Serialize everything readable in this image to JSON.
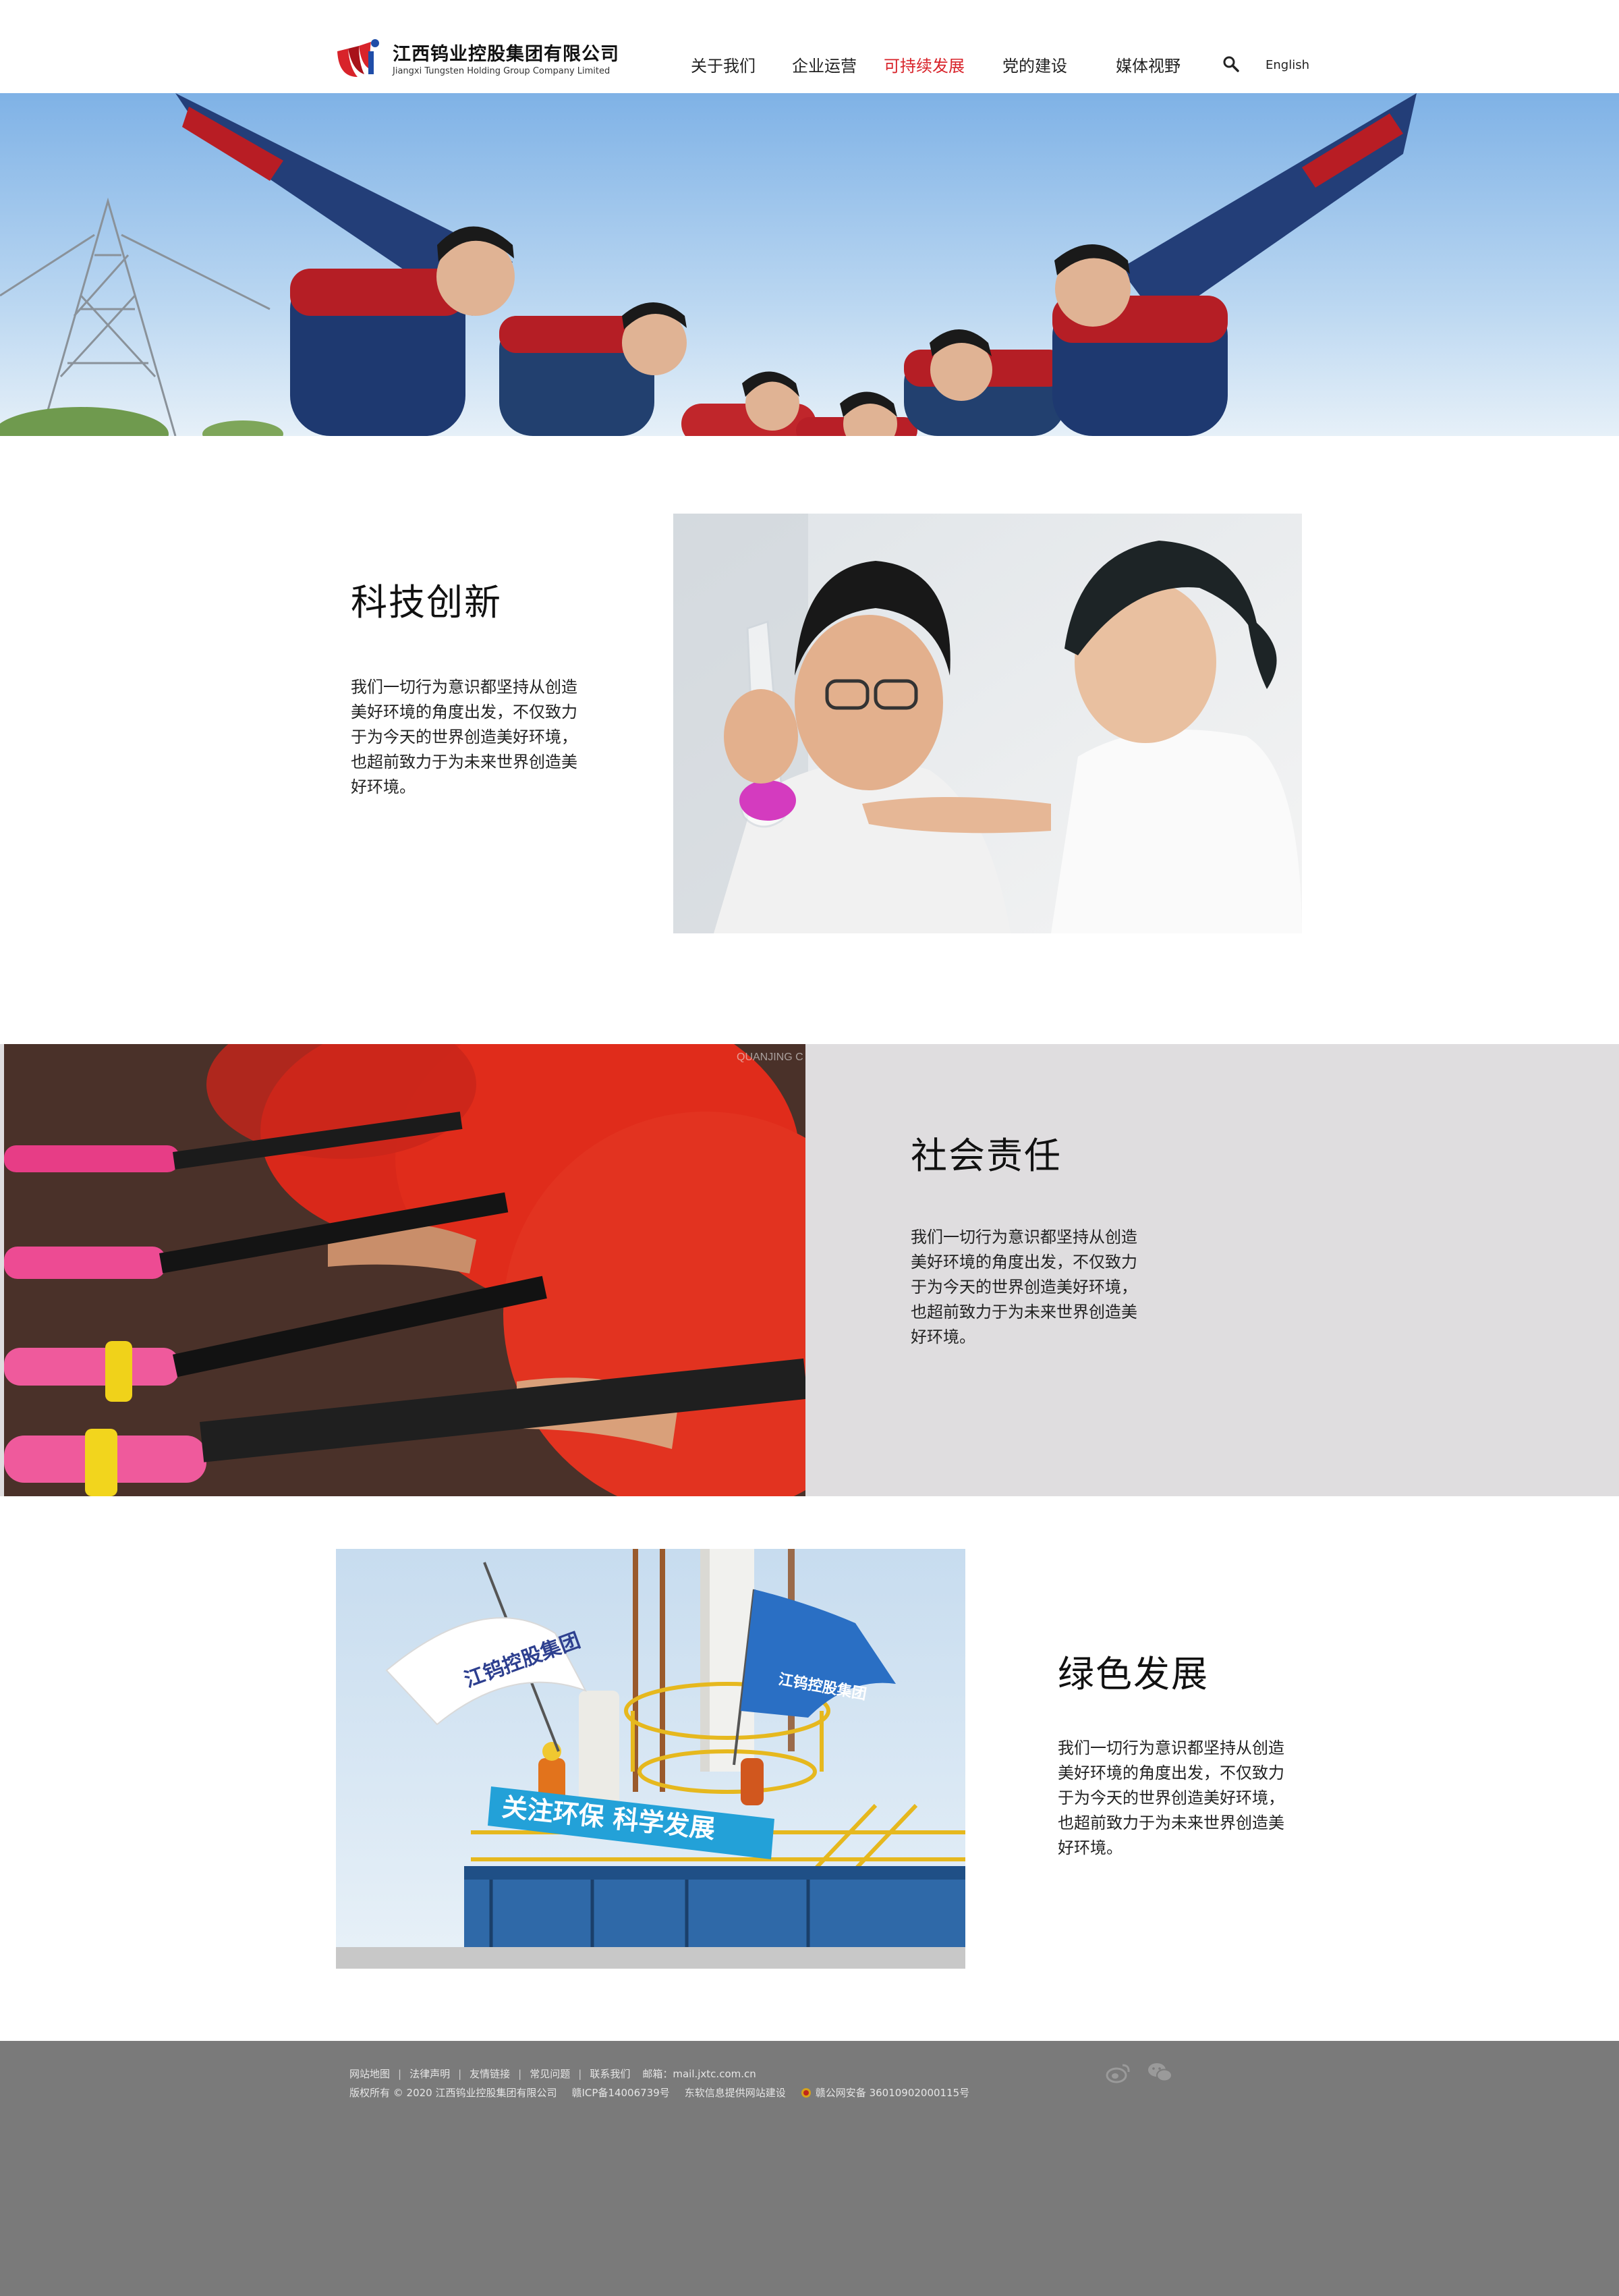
{
  "header": {
    "logo_cn": "江西钨业控股集团有限公司",
    "logo_en": "Jiangxi Tungsten Holding Group Company Limited",
    "nav": [
      {
        "label": "关于我们",
        "active": false
      },
      {
        "label": "企业运营",
        "active": false
      },
      {
        "label": "可持续发展",
        "active": true
      },
      {
        "label": "党的建设",
        "active": false
      },
      {
        "label": "媒体视野",
        "active": false
      }
    ],
    "search_icon": "search-icon",
    "lang_label": "English"
  },
  "sections": {
    "tech": {
      "title": "科技创新",
      "body": "我们一切行为意识都坚持从创造美好环境的角度出发，不仅致力于为今天的世界创造美好环境，也超前致力于为未来世界创造美好环境。"
    },
    "social": {
      "title": "社会责任",
      "body": "我们一切行为意识都坚持从创造美好环境的角度出发，不仅致力于为今天的世界创造美好环境，也超前致力于为未来世界创造美好环境。",
      "photo_watermark": "QUANJING C"
    },
    "green": {
      "title": "绿色发展",
      "body": "我们一切行为意识都坚持从创造美好环境的角度出发，不仅致力于为今天的世界创造美好环境，也超前致力于为未来世界创造美好环境。",
      "flag_left": "江钨控股集团",
      "flag_right": "江钨控股集团",
      "banner": "关注环保  科学发展"
    }
  },
  "footer": {
    "links": [
      "网站地图",
      "法律声明",
      "友情链接",
      "常见问题",
      "联系我们"
    ],
    "mail_label": "邮箱：",
    "mail": "mail.jxtc.com.cn",
    "copyright": "版权所有 © 2020 江西钨业控股集团有限公司",
    "icp": "赣ICP备14006739号",
    "builder": "东软信息提供网站建设",
    "police": "赣公网安备 36010902000115号",
    "social_icons": [
      "weibo-icon",
      "wechat-icon"
    ]
  },
  "colors": {
    "accent": "#d8232a",
    "band_bg": "#dfdddf",
    "footer_bg": "#7a7a7a"
  }
}
